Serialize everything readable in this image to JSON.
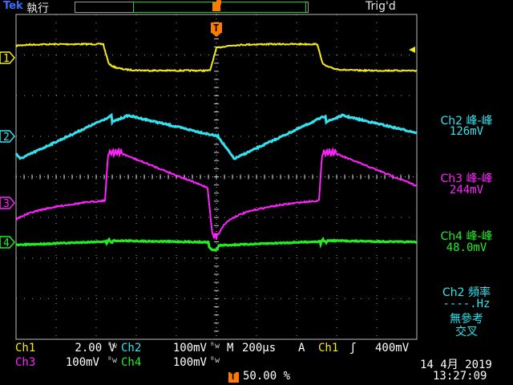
{
  "status": {
    "brand": "Tek",
    "run_state": "執行",
    "trigger_state": "Trig'd"
  },
  "colors": {
    "ch1": "#f5eb1a",
    "ch2": "#33e2ee",
    "ch3": "#ff22ff",
    "ch4": "#22ee22",
    "grid": "#d0d0d0",
    "trigger": "#ff7a00",
    "status_text": "#cfcfcf"
  },
  "channel_markers": [
    "1",
    "2",
    "3",
    "4"
  ],
  "trigger_marker": "T",
  "measurements": [
    {
      "title": "Ch2 峰-峰",
      "value": "126mV"
    },
    {
      "title": "Ch3 峰-峰",
      "value": "244mV"
    },
    {
      "title": "Ch4 峰-峰",
      "value": "48.0mV"
    },
    {
      "title": "Ch2 頻率",
      "value": "----.Hz",
      "note1": "無參考",
      "note2": "交叉"
    }
  ],
  "bottom": {
    "ch1_label": "Ch1",
    "ch1_scale": "2.00 V",
    "ch2_label": "Ch2",
    "ch2_scale": "100mV",
    "ch3_label": "Ch3",
    "ch3_scale": "100mV",
    "ch4_label": "Ch4",
    "ch4_scale": "100mV",
    "bw_symbol": "ᴮw",
    "timebase_label": "M",
    "timebase_value": "200µs",
    "trigger_source_prefix": "A",
    "trigger_source": "Ch1",
    "trigger_slope": "ʃ",
    "trigger_level": "400mV",
    "trigger_position_marker": "T",
    "trigger_position": "50.00 %",
    "date": "14 4月  2019",
    "time": "13:27:09"
  }
}
